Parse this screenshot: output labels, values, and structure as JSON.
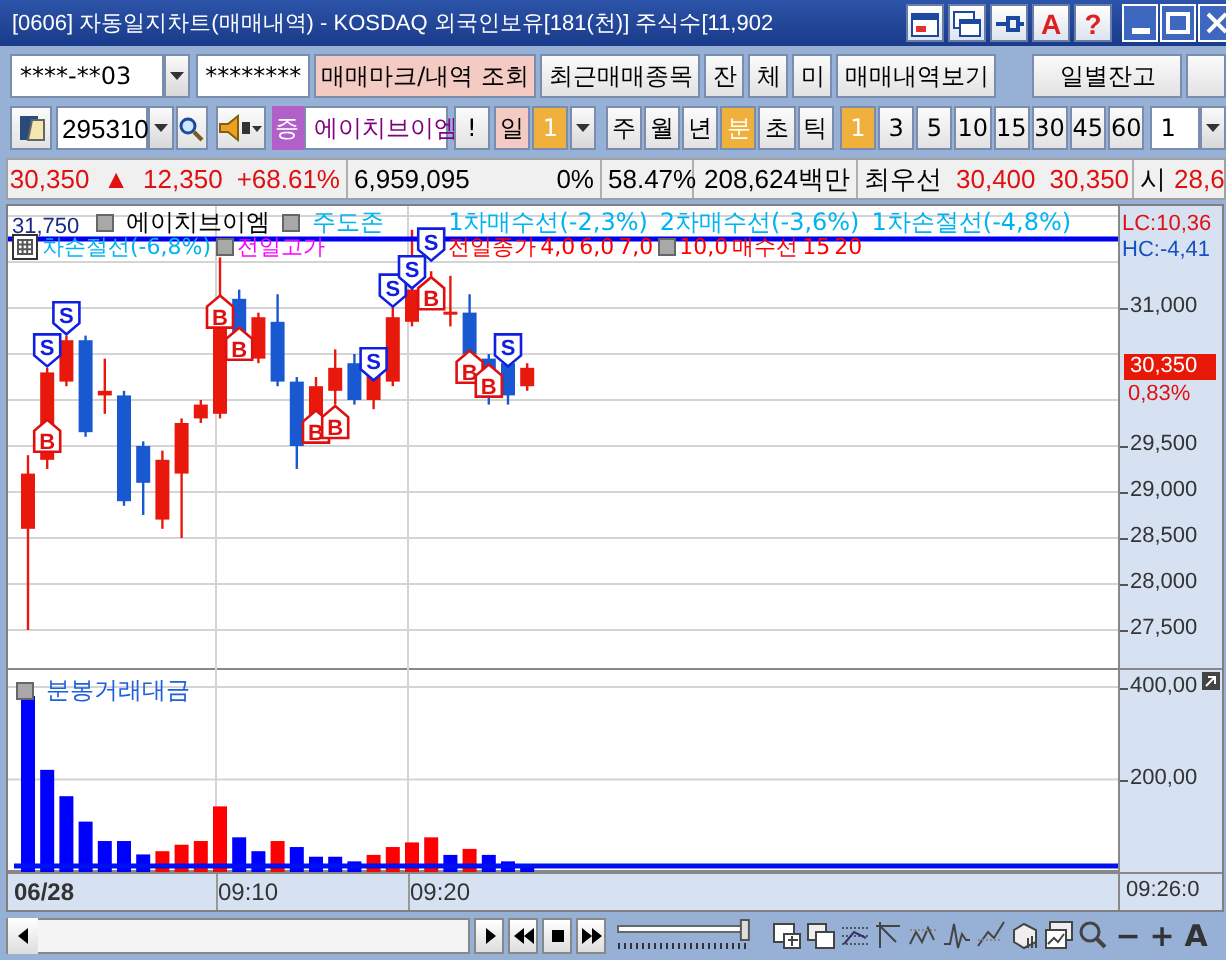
{
  "window": {
    "title": "[0606] 자동일지차트(매매내역) - KOSDAQ 외국인보유[181(천)] 주식수[11,902",
    "tools": [
      {
        "kind": "window"
      },
      {
        "kind": "cascade"
      },
      {
        "kind": "pin"
      },
      {
        "kind": "font",
        "glyph": "A"
      },
      {
        "kind": "help",
        "glyph": "?"
      }
    ]
  },
  "account_bar": {
    "account": "****-**03",
    "password": "********",
    "buttons": [
      {
        "label": "매매마크/내역 조회",
        "kind": "accent"
      },
      {
        "label": "최근매매종목",
        "kind": "plain"
      },
      {
        "label": "잔",
        "kind": "plain"
      },
      {
        "label": "체",
        "kind": "plain"
      },
      {
        "label": "미",
        "kind": "plain"
      },
      {
        "label": "매매내역보기",
        "kind": "plain"
      },
      {
        "label": "일별잔고",
        "kind": "spaced"
      }
    ]
  },
  "symbol_bar": {
    "code": "295310",
    "market_badge": "증",
    "name": "에이치브이엠",
    "alert": "!",
    "period_label": "일",
    "period_value": "1",
    "units": [
      {
        "label": "주",
        "selected": false
      },
      {
        "label": "월",
        "selected": false
      },
      {
        "label": "년",
        "selected": false
      },
      {
        "label": "분",
        "selected": true
      },
      {
        "label": "초",
        "selected": false
      },
      {
        "label": "틱",
        "selected": false
      }
    ],
    "intervals": [
      {
        "label": "1",
        "selected": true
      },
      {
        "label": "3",
        "selected": false
      },
      {
        "label": "5",
        "selected": false
      },
      {
        "label": "10",
        "selected": false
      },
      {
        "label": "15",
        "selected": false
      },
      {
        "label": "30",
        "selected": false
      },
      {
        "label": "45",
        "selected": false
      },
      {
        "label": "60",
        "selected": false
      }
    ],
    "count": "1"
  },
  "quote_bar": {
    "price": "30,350",
    "change_mark": "▲",
    "change": "12,350",
    "change_rate": "+68.61%",
    "volume": "6,959,095",
    "ratio": "0%",
    "foreign_ratio": "58.47%",
    "amount": "208,624백만",
    "best_label": "최우선",
    "ask": "30,400",
    "bid": "30,350",
    "open_label": "시",
    "open": "28,6"
  },
  "price_chart": {
    "legend_rows": [
      [
        {
          "label": "에이치브이엠",
          "color": "#000000",
          "marker": true
        },
        {
          "label": "주도존",
          "color": "#00b4f0",
          "marker": true
        },
        {
          "label": "1차매수선(-2,3%)",
          "color": "#00b4f0",
          "marker": false
        },
        {
          "label": "2차매수선(-3,6%)",
          "color": "#00b4f0",
          "marker": false
        },
        {
          "label": "1차손절선(-4,8%)",
          "color": "#00b4f0",
          "marker": false
        }
      ],
      [
        {
          "label": "차손절선(-6,8%)",
          "color": "#00b4f0",
          "marker": false
        },
        {
          "label": "전일고가",
          "color": "#ff00ff",
          "marker": true
        },
        {
          "label": "전일종가",
          "color": "#ff0000",
          "marker": false
        },
        {
          "label": "4,0",
          "color": "#ff0000",
          "marker": false
        },
        {
          "label": "6,0",
          "color": "#ff0000",
          "marker": false
        },
        {
          "label": "7,0",
          "color": "#ff0000",
          "marker": false
        },
        {
          "label": "10,0",
          "color": "#ff0000",
          "marker": true
        },
        {
          "label": "매수선",
          "color": "#ff0000",
          "marker": false
        },
        {
          "label": "15",
          "color": "#ff0000",
          "marker": false
        },
        {
          "label": "20",
          "color": "#ff0000",
          "marker": false
        }
      ]
    ],
    "level_label": "31,750",
    "axis_labels": [
      "31,000",
      "29,500",
      "29,000",
      "28,500",
      "28,000",
      "27,500"
    ],
    "lc": "LC:10,36",
    "hc": "HC:-4,41",
    "last_price": "30,350",
    "last_change": "0,83%",
    "trade_marks": [
      {
        "kind": "sell",
        "text": "S"
      },
      {
        "kind": "sell",
        "text": "S"
      },
      {
        "kind": "sell",
        "text": "S"
      },
      {
        "kind": "sell",
        "text": "S"
      },
      {
        "kind": "sell",
        "text": "S"
      },
      {
        "kind": "sell",
        "text": "S"
      },
      {
        "kind": "sell",
        "text": "S"
      },
      {
        "kind": "buy",
        "text": "B"
      },
      {
        "kind": "buy",
        "text": "B"
      },
      {
        "kind": "buy",
        "text": "B"
      },
      {
        "kind": "buy",
        "text": "B"
      },
      {
        "kind": "buy",
        "text": "B"
      },
      {
        "kind": "buy",
        "text": "B"
      },
      {
        "kind": "buy",
        "text": "B"
      },
      {
        "kind": "buy",
        "text": "B"
      }
    ]
  },
  "volume_chart": {
    "legend": "분봉거래대금",
    "axis_labels": [
      "400,00",
      "200,00"
    ]
  },
  "time_labels": [
    "06/28",
    "09:10",
    "09:20"
  ],
  "current_time": "09:26:0",
  "zoom_slider": {
    "level": 0.96
  },
  "chart_tools": [
    {
      "kind": "split"
    },
    {
      "kind": "overlap"
    },
    {
      "kind": "dotted"
    },
    {
      "kind": "axis"
    },
    {
      "kind": "wave"
    },
    {
      "kind": "spike"
    },
    {
      "kind": "trend"
    },
    {
      "kind": "cube"
    },
    {
      "kind": "picture"
    },
    {
      "kind": "zoom"
    },
    {
      "kind": "zoom_out",
      "glyph": "−"
    },
    {
      "kind": "zoom_in",
      "glyph": "+"
    },
    {
      "kind": "font",
      "glyph": "A"
    }
  ]
}
